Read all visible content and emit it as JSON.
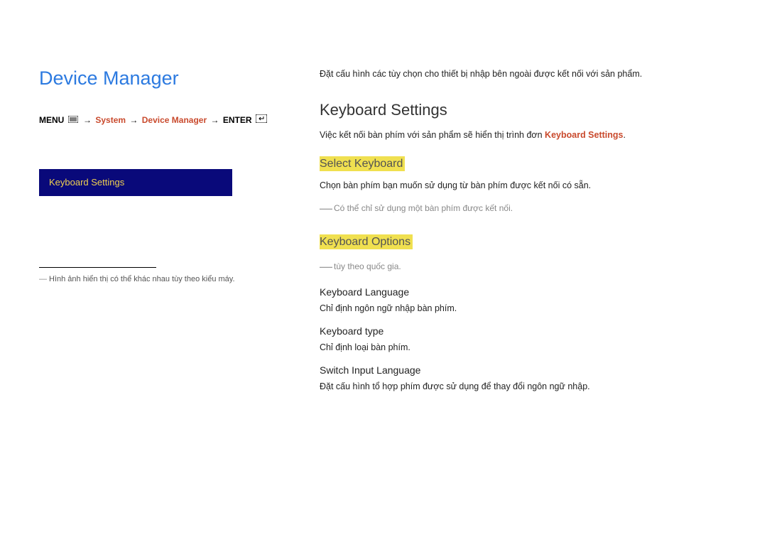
{
  "left": {
    "title": "Device Manager",
    "breadcrumb": {
      "menu": "MENU",
      "system": "System",
      "device_manager": "Device Manager",
      "enter": "ENTER"
    },
    "menubox": "Keyboard Settings",
    "footnote": "Hình ảnh hiển thị có thể khác nhau tùy theo kiểu máy."
  },
  "right": {
    "intro": "Đặt cấu hình các tùy chọn cho thiết bị nhập bên ngoài được kết nối với sản phẩm.",
    "section_title": "Keyboard Settings",
    "section_desc_pre": "Việc kết nối bàn phím với sản phẩm sẽ hiển thị trình đơn ",
    "section_desc_highlight": "Keyboard Settings",
    "section_desc_post": ".",
    "select_keyboard": {
      "heading": "Select Keyboard",
      "desc": "Chọn bàn phím bạn muốn sử dụng từ bàn phím được kết nối có sẵn.",
      "note": "Có thể chỉ sử dụng một bàn phím được kết nối."
    },
    "keyboard_options": {
      "heading": "Keyboard Options",
      "note": "tùy theo quốc gia.",
      "lang": {
        "title": "Keyboard Language",
        "desc": "Chỉ định ngôn ngữ nhập bàn phím."
      },
      "type": {
        "title": "Keyboard type",
        "desc": "Chỉ định loại bàn phím."
      },
      "switch": {
        "title": "Switch Input Language",
        "desc": "Đặt cấu hình tổ hợp phím được sử dụng để thay đổi ngôn ngữ nhập."
      }
    }
  }
}
